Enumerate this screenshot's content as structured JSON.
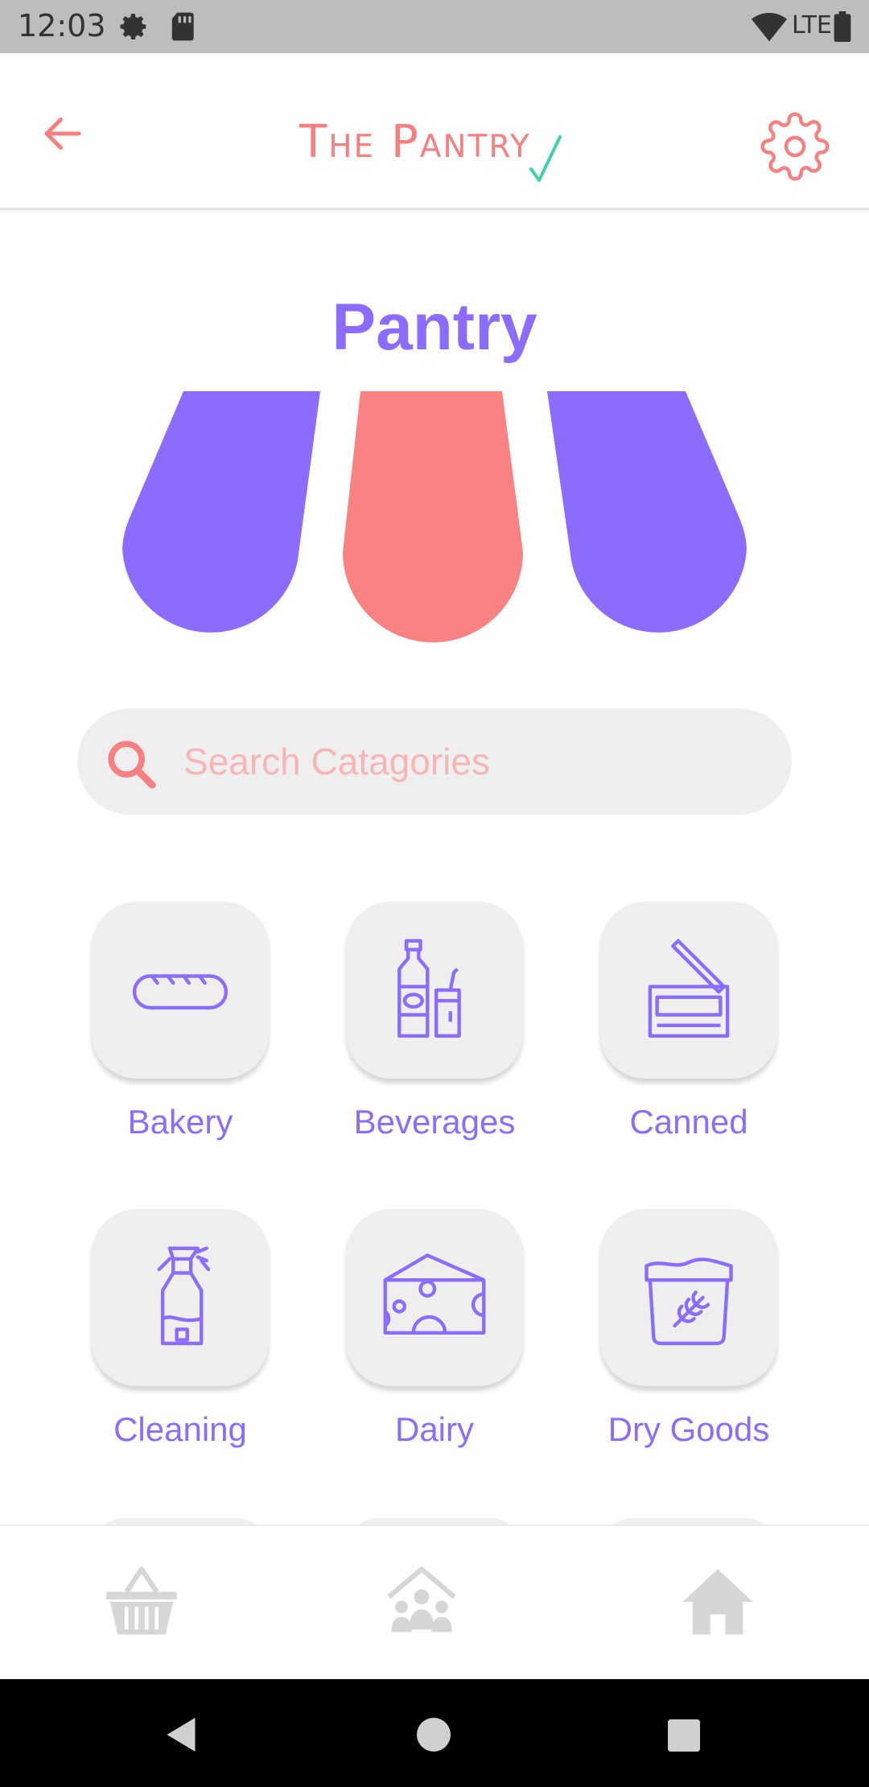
{
  "status_bar": {
    "time": "12:03",
    "network": "LTE"
  },
  "app_bar": {
    "logo_text": "The Pantry"
  },
  "page": {
    "title": "Pantry"
  },
  "search": {
    "placeholder": "Search Catagories"
  },
  "categories": [
    {
      "label": "Bakery",
      "icon": "bread-icon"
    },
    {
      "label": "Beverages",
      "icon": "bottle-cup-icon"
    },
    {
      "label": "Canned",
      "icon": "can-icon"
    },
    {
      "label": "Cleaning",
      "icon": "spray-bottle-icon"
    },
    {
      "label": "Dairy",
      "icon": "cheese-icon"
    },
    {
      "label": "Dry Goods",
      "icon": "grain-bag-icon"
    }
  ],
  "bottom_nav": [
    {
      "icon": "basket-icon"
    },
    {
      "icon": "community-icon"
    },
    {
      "icon": "home-icon"
    }
  ],
  "colors": {
    "accent": "#8b6cff",
    "brand": "#f77f7f",
    "tile": "#efefef"
  }
}
